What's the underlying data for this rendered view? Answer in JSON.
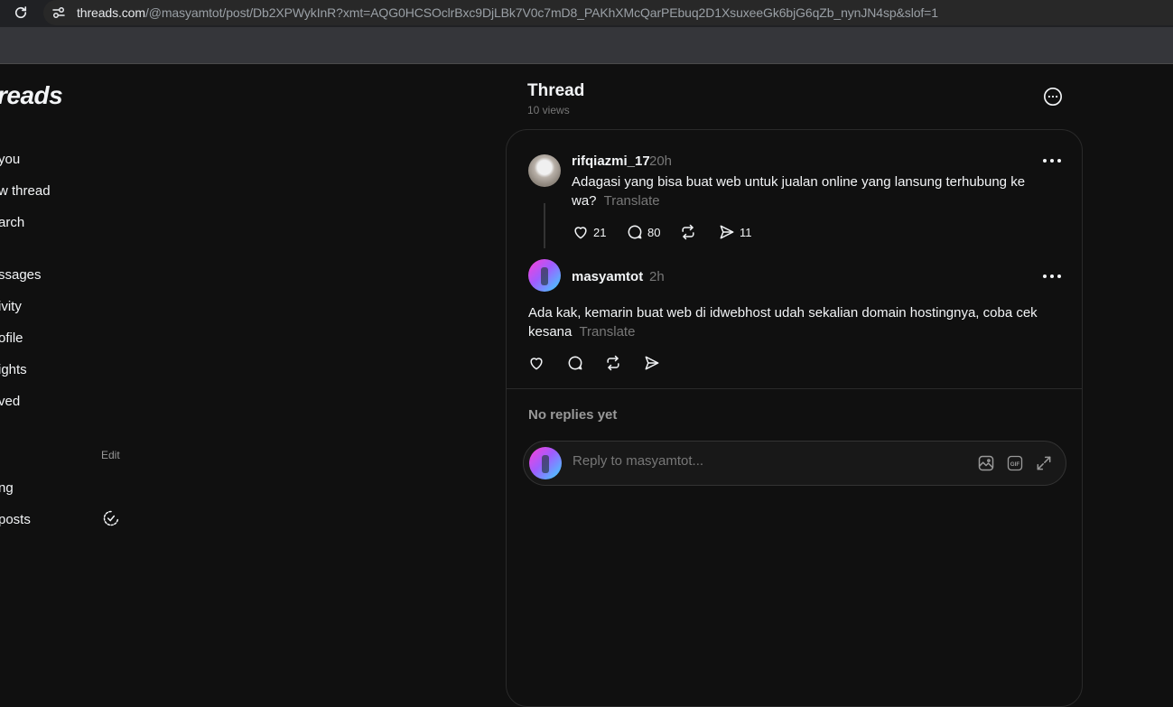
{
  "browser": {
    "url_host": "threads.com",
    "url_path": "/@masyamtot/post/Db2XPWykInR?xmt=AQG0HCSOclrBxc9DjLBk7V0c7mD8_PAKhXMcQarPEbuq2D1XsuxeeGk6bjG6qZb_nynJN4sp&slof=1"
  },
  "sidebar": {
    "logo": "reads",
    "items": [
      {
        "label": "you"
      },
      {
        "label": "w thread"
      },
      {
        "label": "arch"
      },
      {
        "label": "ssages"
      },
      {
        "label": "ivity"
      },
      {
        "label": "ofile"
      },
      {
        "label": "ights"
      },
      {
        "label": "ved"
      }
    ],
    "edit_label": "Edit",
    "feeds": [
      {
        "label": "ng"
      },
      {
        "label": "posts"
      }
    ]
  },
  "header": {
    "title": "Thread",
    "views": "10 views"
  },
  "post": {
    "username": "rifqiazmi_17",
    "time": "20h",
    "text": "Adagasi yang bisa buat web untuk jualan online yang lansung terhubung ke wa?",
    "translate": "Translate",
    "likes": "21",
    "comments": "80",
    "shares": "11"
  },
  "reply": {
    "username": "masyamtot",
    "time": "2h",
    "text": "Ada kak, kemarin buat web di idwebhost udah sekalian domain hostingnya, coba cek kesana",
    "translate": "Translate"
  },
  "replies": {
    "empty_label": "No replies yet"
  },
  "reply_box": {
    "placeholder": "Reply to masyamtot..."
  }
}
